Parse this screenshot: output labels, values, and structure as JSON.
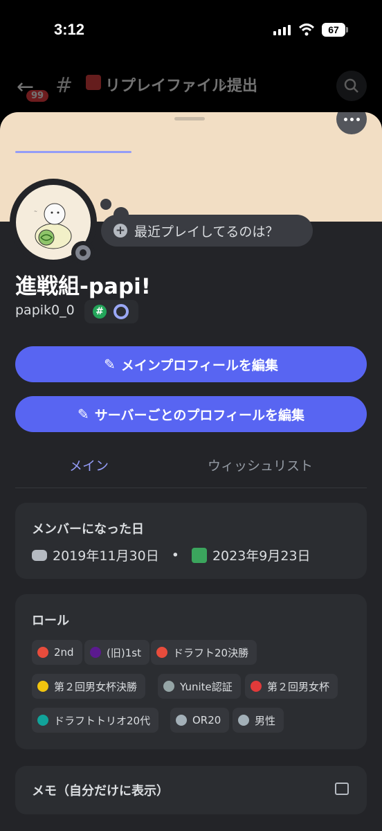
{
  "status_bar": {
    "time": "3:12",
    "battery": "67"
  },
  "channel_header": {
    "unread_count": "99",
    "channel_name": "リプレイファイル提出"
  },
  "profile": {
    "status_prompt": "最近プレイしてるのは？",
    "display_name": "進戦組-papi!",
    "username": "papik0_0",
    "badge_hash_symbol": "#"
  },
  "buttons": {
    "edit_main_profile": "メインプロフィールを編集",
    "edit_server_profile": "サーバーごとのプロフィールを編集"
  },
  "tabs": [
    {
      "label": "メイン",
      "active": true
    },
    {
      "label": "ウィッシュリスト",
      "active": false
    }
  ],
  "member_since": {
    "title": "メンバーになった日",
    "discord_date": "2019年11月30日",
    "separator": "•",
    "server_date": "2023年9月23日"
  },
  "roles": {
    "title": "ロール",
    "items": [
      {
        "label": "2nd",
        "color": "#e74c3c"
      },
      {
        "label": "(旧)1st",
        "color": "#5b1a8f"
      },
      {
        "label": "ドラフト20決勝",
        "color": "#e74c3c"
      },
      {
        "label": "第２回男女杯決勝",
        "color": "#f1c40f"
      },
      {
        "label": "Yunite認証",
        "color": "#95a5a6"
      },
      {
        "label": "第２回男女杯",
        "color": "#e03a3a"
      },
      {
        "label": "ドラフトトリオ20代",
        "color": "#11a39a"
      },
      {
        "label": "OR20",
        "color": "#a3b0b8"
      },
      {
        "label": "男性",
        "color": "#a3b0b8"
      }
    ]
  },
  "memo": {
    "title": "メモ（自分だけに表示）"
  },
  "colors": {
    "accent": "#5865f2",
    "tab_active": "#949cf7",
    "banner": "#f2dec4"
  },
  "icons": [
    "back-arrow-icon",
    "hash-lock-icon",
    "search-icon",
    "more-icon",
    "plus-icon",
    "pencil-icon",
    "discord-icon",
    "server-icon",
    "memo-edit-icon"
  ]
}
